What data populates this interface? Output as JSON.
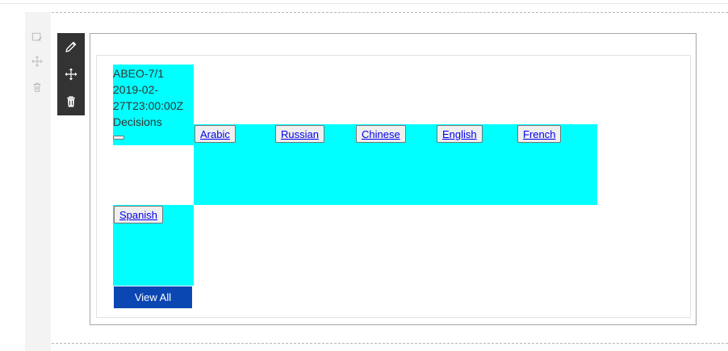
{
  "rail": {
    "icons": [
      "edit-note-icon",
      "move-icon",
      "trash-icon"
    ]
  },
  "toolbar": {
    "buttons": [
      "pencil-icon",
      "move-arrows-icon",
      "trash-icon"
    ]
  },
  "document": {
    "symbol": "ABEO-7/1",
    "date_line1": "2019-02-",
    "date_line2": "27T23:00:00Z",
    "type": "Decisions",
    "languages": [
      "Arabic",
      "Russian",
      "Chinese",
      "English",
      "French",
      "Spanish"
    ],
    "view_all_label": "View All"
  },
  "colors": {
    "highlight": "#00ffff",
    "primary_button": "#0b47b3",
    "toolbar_bg": "#333333",
    "link": "#0000ee"
  }
}
